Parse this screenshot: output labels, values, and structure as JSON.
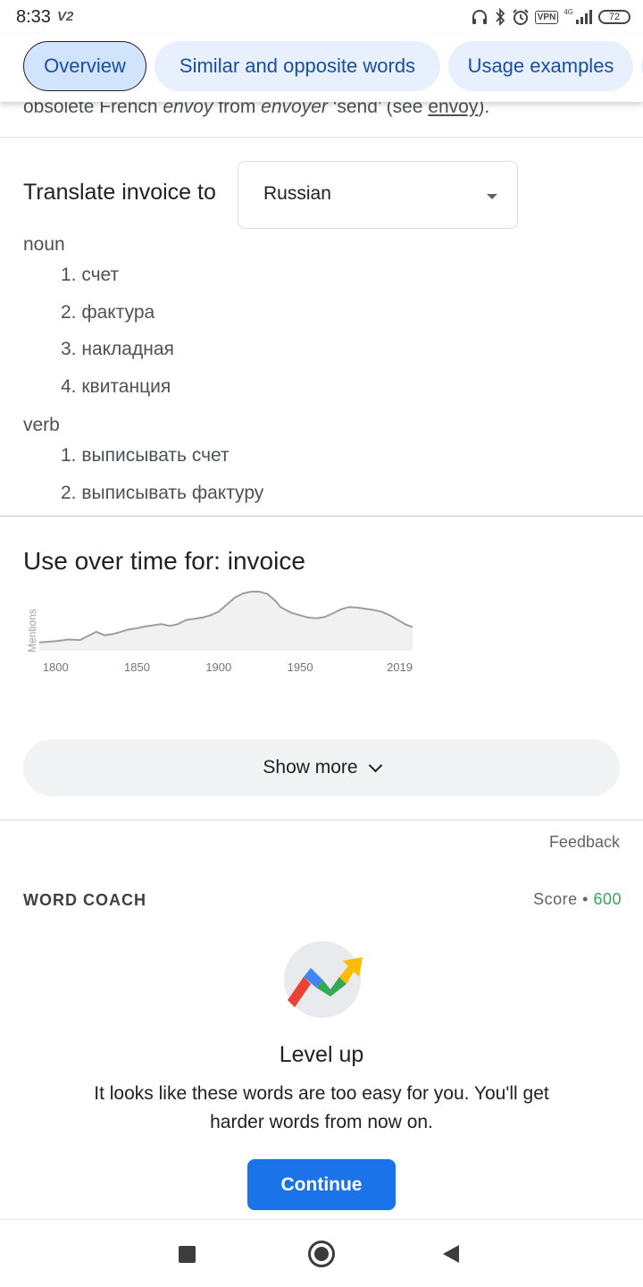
{
  "status_bar": {
    "time": "8:33",
    "carrier_tag": "V2",
    "vpn_label": "VPN",
    "network_label": "4G",
    "battery": "72",
    "icons": [
      "headphones-icon",
      "bluetooth-icon",
      "alarm-icon",
      "vpn-icon",
      "signal-icon",
      "battery-icon"
    ]
  },
  "tabs": [
    {
      "label": "Overview",
      "active": true
    },
    {
      "label": "Similar and opposite words",
      "active": false
    },
    {
      "label": "Usage examples",
      "active": false
    }
  ],
  "etymology": {
    "part1": "obsolete French ",
    "italic1": "envoy",
    "part2": " from ",
    "italic2": "envoyer",
    "part3": " ‘send’ (see ",
    "link": "envoy",
    "part4": ")."
  },
  "translate": {
    "label": "Translate invoice to",
    "selected_language": "Russian",
    "groups": [
      {
        "pos": "noun",
        "items": [
          "1. счет",
          "2. фактура",
          "3. накладная",
          "4. квитанция"
        ]
      },
      {
        "pos": "verb",
        "items": [
          "1. выписывать счет",
          "2. выписывать фактуру"
        ]
      }
    ]
  },
  "use_over_time": {
    "title": "Use over time for: invoice"
  },
  "chart_data": {
    "type": "area",
    "title": "",
    "xlabel": "",
    "ylabel": "Mentions",
    "x_ticks": [
      "1800",
      "1850",
      "1900",
      "1950",
      "2019"
    ],
    "xlim": [
      1790,
      2019
    ],
    "ylim": [
      0,
      100
    ],
    "grid": false,
    "x": [
      1790,
      1800,
      1808,
      1815,
      1820,
      1825,
      1830,
      1835,
      1840,
      1845,
      1850,
      1855,
      1860,
      1865,
      1870,
      1875,
      1880,
      1885,
      1890,
      1895,
      1900,
      1905,
      1910,
      1915,
      1920,
      1925,
      1930,
      1935,
      1938,
      1942,
      1945,
      1950,
      1955,
      1960,
      1965,
      1970,
      1975,
      1980,
      1985,
      1990,
      1995,
      2000,
      2005,
      2010,
      2015,
      2019
    ],
    "values": [
      14,
      16,
      19,
      18,
      25,
      32,
      26,
      28,
      32,
      36,
      38,
      41,
      43,
      45,
      42,
      45,
      52,
      54,
      56,
      60,
      66,
      78,
      90,
      97,
      100,
      100,
      96,
      84,
      74,
      68,
      64,
      60,
      56,
      55,
      57,
      63,
      70,
      74,
      73,
      71,
      69,
      66,
      60,
      52,
      44,
      40
    ],
    "series": [
      {
        "values_ref": "values"
      }
    ]
  },
  "show_more": {
    "label": "Show more"
  },
  "feedback": {
    "label": "Feedback"
  },
  "word_coach": {
    "title": "WORD COACH",
    "score_label": "Score",
    "score_sep": " • ",
    "score_value": "600",
    "level_title": "Level up",
    "level_text": "It looks like these words are too easy for you. You'll get harder words from now on.",
    "continue_label": "Continue"
  },
  "colors": {
    "accent": "#1a73e8",
    "chip_bg": "#e8f0fe",
    "chip_text": "#174ea6",
    "score_green": "#34a853",
    "chart_line": "#9e9e9e",
    "chart_fill": "#f1f1f1"
  }
}
